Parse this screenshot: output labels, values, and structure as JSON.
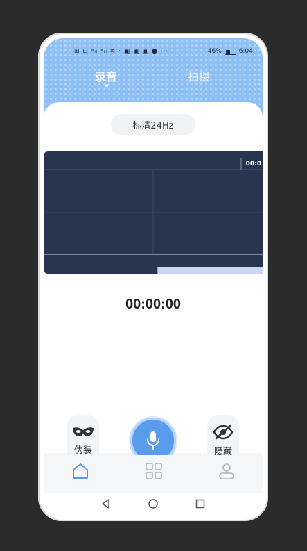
{
  "status_bar": {
    "left_icons": "⊞ ⊟ ᵃᵢₗ ᵃᵢₗ ≋ · ▣ ▣ ▣ ● ···",
    "battery_percent": "46%",
    "time": "6:04"
  },
  "tabs": {
    "record_label": "录音",
    "photo_label": "拍摄"
  },
  "quality": {
    "label": "标清24Hz"
  },
  "waveform": {
    "time_label": "00:0",
    "progress_fraction": 0.48
  },
  "timer": {
    "value": "00:00:00"
  },
  "actions": {
    "disguise_label": "伪装",
    "hide_label": "隐藏"
  },
  "colors": {
    "header": "#8ec0f6",
    "accent": "#5a9cec",
    "wave_bg": "#29344f",
    "nav_active": "#5a9cec",
    "nav_inactive": "#b7bcc4"
  },
  "bottom_nav": {
    "items": [
      "home-icon",
      "apps-icon",
      "user-icon"
    ]
  }
}
